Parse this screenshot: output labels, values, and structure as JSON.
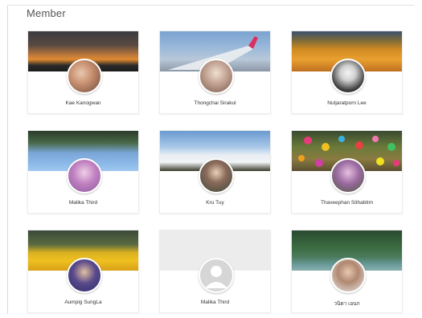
{
  "section": {
    "title": "Member"
  },
  "members": [
    {
      "name": "Kae Kanogwan"
    },
    {
      "name": "Thongchai Sirakul"
    },
    {
      "name": "Nutjaratporn Lee"
    },
    {
      "name": "Malika Third"
    },
    {
      "name": "Kru Tuy"
    },
    {
      "name": "Thaveephan Sithabtim"
    },
    {
      "name": "Aumpig SungLa"
    },
    {
      "name": "Malika Third"
    },
    {
      "name": "วนิดา เอนก"
    }
  ],
  "icons": {
    "default_avatar": "user-silhouette-icon"
  }
}
